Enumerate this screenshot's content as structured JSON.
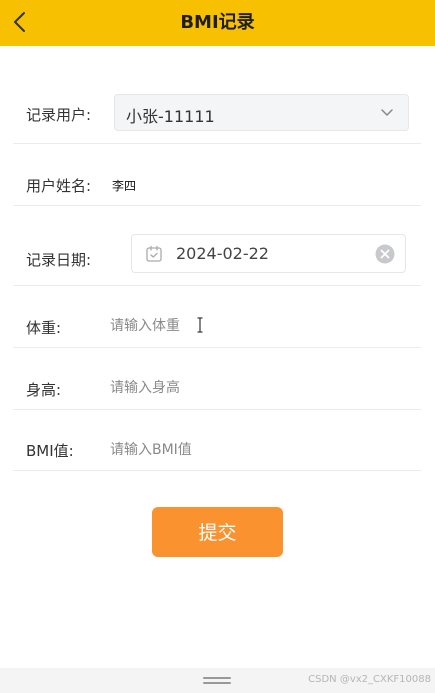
{
  "header": {
    "title": "BMI记录",
    "back_icon": "chevron-left-icon"
  },
  "form": {
    "user": {
      "label": "记录用户:",
      "value": "小张-11111"
    },
    "name": {
      "label": "用户姓名:",
      "value": "李四"
    },
    "date": {
      "label": "记录日期:",
      "value": "2024-02-22"
    },
    "weight": {
      "label": "体重:",
      "placeholder": "请输入体重"
    },
    "height": {
      "label": "身高:",
      "placeholder": "请输入身高"
    },
    "bmi": {
      "label": "BMI值:",
      "placeholder": "请输入BMI值"
    }
  },
  "submit_label": "提交",
  "colors": {
    "header_bg": "#f7c000",
    "submit_bg": "#fb9230"
  },
  "watermark": "CSDN @vx2_CXKF10088"
}
